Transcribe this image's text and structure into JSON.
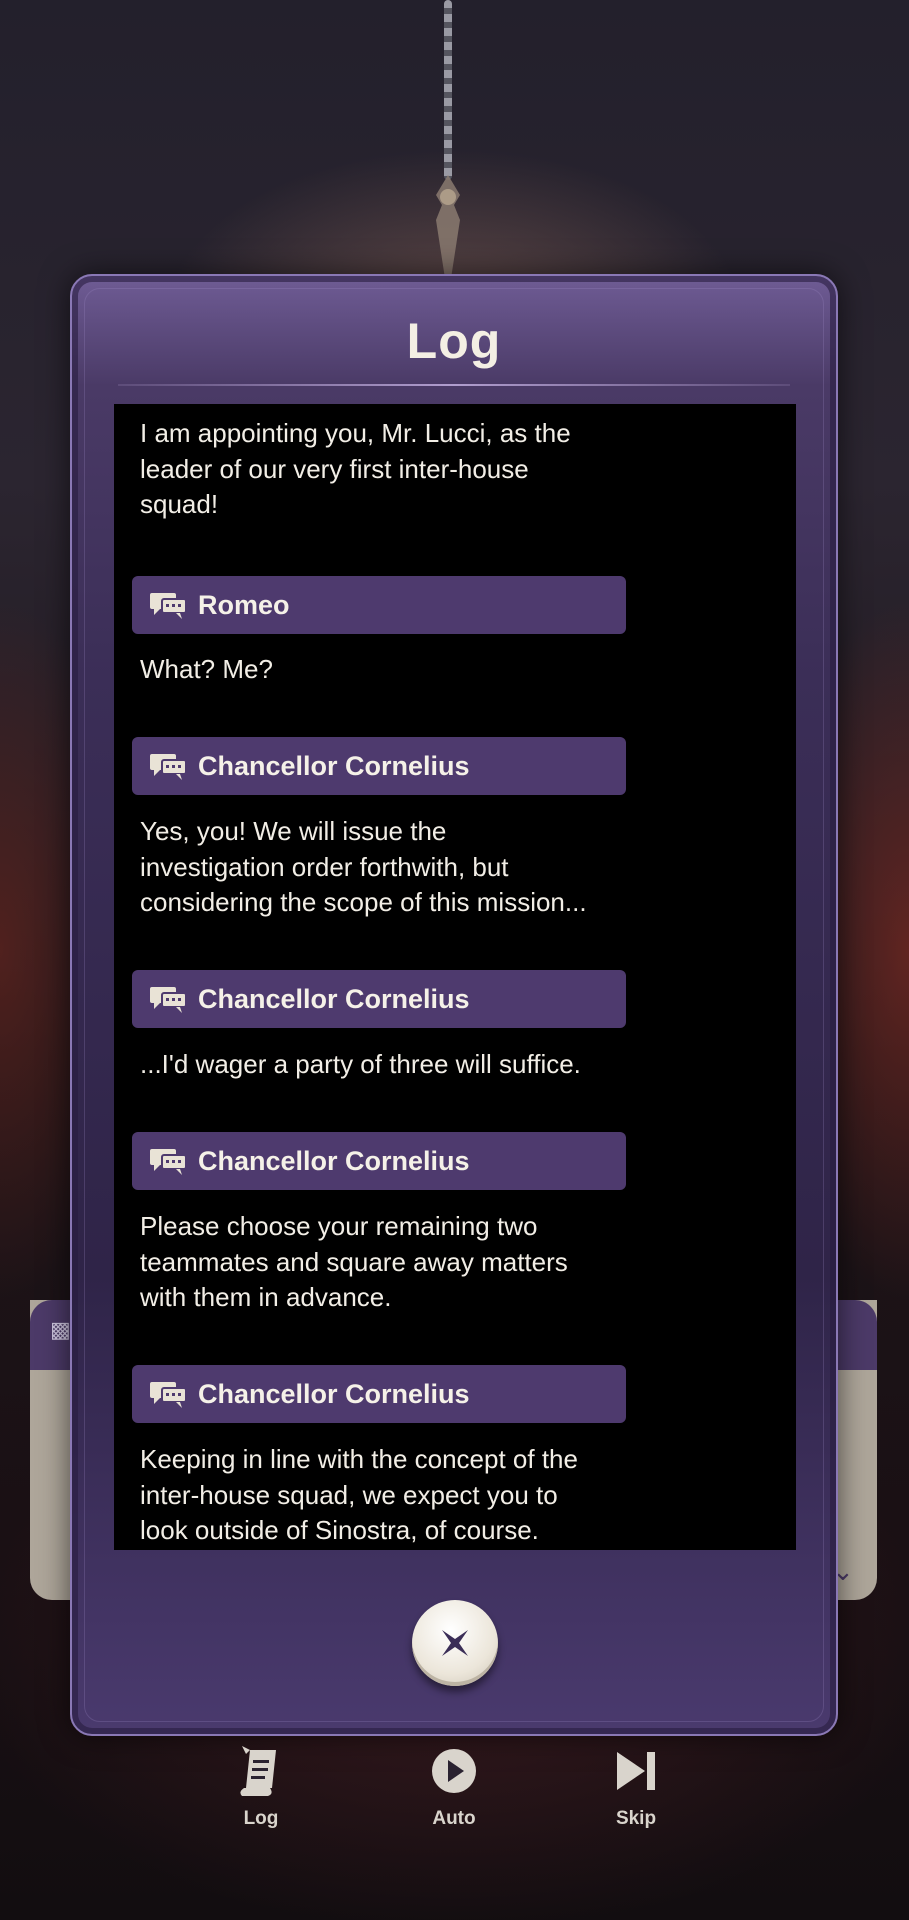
{
  "dialog": {
    "title": "Log",
    "entries": [
      {
        "speaker": "",
        "text": "I am appointing you, Mr. Lucci, as the\nleader of our very first inter-house\nsquad!"
      },
      {
        "speaker": "Romeo",
        "text": "What? Me?"
      },
      {
        "speaker": "Chancellor Cornelius",
        "text": "Yes, you! We will issue the\ninvestigation order forthwith, but\nconsidering the scope of this mission..."
      },
      {
        "speaker": "Chancellor Cornelius",
        "text": "...I'd wager a party of three will suffice."
      },
      {
        "speaker": "Chancellor Cornelius",
        "text": "Please choose your remaining two\nteammates and square away matters\nwith them in advance."
      },
      {
        "speaker": "Chancellor Cornelius",
        "text": "Keeping in line with the concept of the\ninter-house squad, we expect you to\nlook outside of Sinostra, of course."
      }
    ]
  },
  "toolbar": {
    "log_label": "Log",
    "auto_label": "Auto",
    "skip_label": "Skip"
  },
  "icons": {
    "speaker": "speech-bubbles-icon",
    "close": "close-x-icon",
    "log": "scroll-icon",
    "auto": "play-icon",
    "skip": "skip-next-icon"
  },
  "colors": {
    "accent_purple": "#4e3a6e",
    "panel_purple": "#3b2e57",
    "text_light": "#f2eee6"
  }
}
